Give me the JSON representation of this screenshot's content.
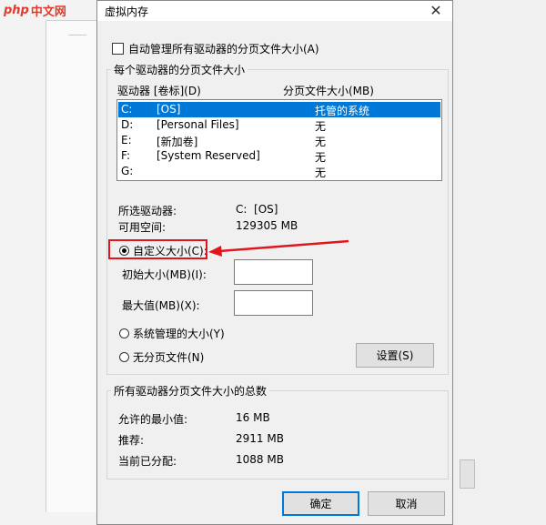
{
  "watermark": {
    "php": "php",
    "cn": "中文网"
  },
  "dialog": {
    "title": "虚拟内存",
    "close_glyph": "✕",
    "auto_manage": {
      "label": "自动管理所有驱动器的分页文件大小(A)",
      "checked": false
    },
    "per_drive_group": {
      "title": "每个驱动器的分页文件大小",
      "col_drive": "驱动器 [卷标](D)",
      "col_size": "分页文件大小(MB)",
      "drives": [
        {
          "drive": "C:",
          "label": "[OS]",
          "size": "托管的系统",
          "selected": true
        },
        {
          "drive": "D:",
          "label": "[Personal Files]",
          "size": "无",
          "selected": false
        },
        {
          "drive": "E:",
          "label": "[新加卷]",
          "size": "无",
          "selected": false
        },
        {
          "drive": "F:",
          "label": "[System Reserved]",
          "size": "无",
          "selected": false
        },
        {
          "drive": "G:",
          "label": "",
          "size": "无",
          "selected": false
        }
      ],
      "selected_drive_label": "所选驱动器:",
      "selected_drive_value": "C:  [OS]",
      "free_space_label": "可用空间:",
      "free_space_value": "129305 MB",
      "custom_size_label": "自定义大小(C):",
      "initial_size_label": "初始大小(MB)(I):",
      "initial_size_value": "",
      "max_size_label": "最大值(MB)(X):",
      "max_size_value": "",
      "system_managed_label": "系统管理的大小(Y)",
      "no_paging_label": "无分页文件(N)",
      "set_button": "设置(S)",
      "selected_option": "custom"
    },
    "totals_group": {
      "title": "所有驱动器分页文件大小的总数",
      "min_allowed_label": "允许的最小值:",
      "min_allowed_value": "16 MB",
      "recommended_label": "推荐:",
      "recommended_value": "2911 MB",
      "current_label": "当前已分配:",
      "current_value": "1088 MB"
    },
    "ok_button": "确定",
    "cancel_button": "取消"
  },
  "colors": {
    "selection": "#0078d7",
    "annotation": "#e0161c",
    "dialog_bg": "#f0f0f0"
  }
}
